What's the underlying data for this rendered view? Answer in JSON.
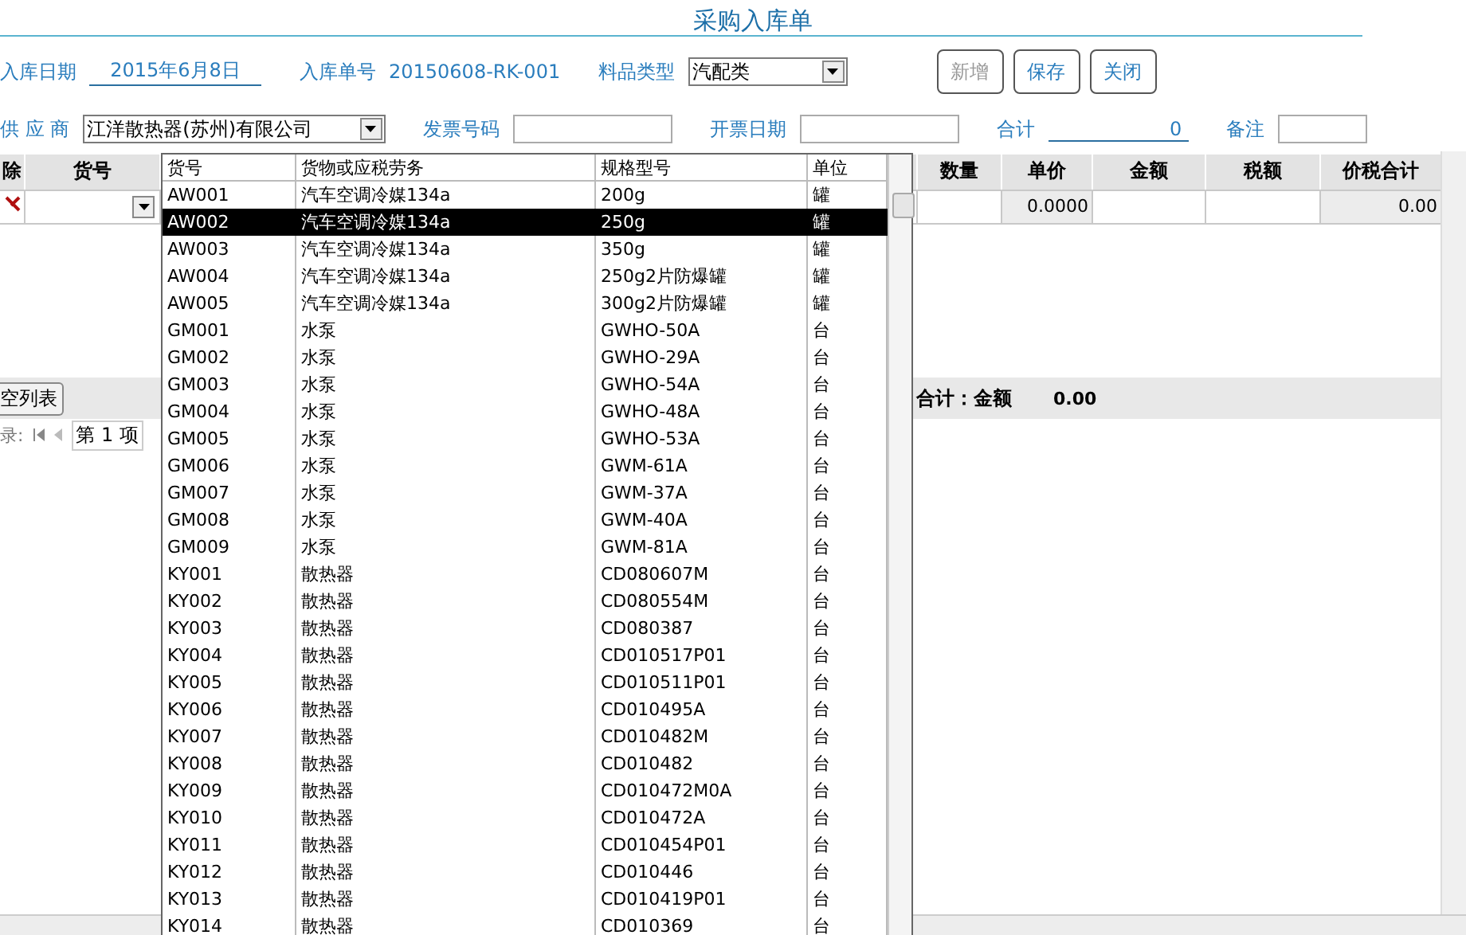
{
  "title": "采购入库单",
  "form_rows": [
    [
      {
        "label": "入库日期",
        "kind": "underline",
        "value": "2015年6月8日"
      },
      {
        "label": "入库单号",
        "kind": "text",
        "value": "20150608-RK-001"
      },
      {
        "label": "料品类型",
        "kind": "select",
        "value": "汽配类"
      }
    ],
    [
      {
        "label": "供 应 商",
        "kind": "select",
        "value": "江洋散热器(苏州)有限公司"
      },
      {
        "label": "发票号码",
        "kind": "input"
      },
      {
        "label": "开票日期",
        "kind": "input"
      },
      {
        "label": "合计",
        "kind": "underline",
        "value": "0"
      },
      {
        "label": "备注",
        "kind": "input"
      }
    ]
  ],
  "buttons": [
    {
      "label": "新增",
      "disabled": true
    },
    {
      "label": "保存",
      "disabled": false
    },
    {
      "label": "关闭",
      "disabled": false
    }
  ],
  "grid": {
    "columns": [
      "除",
      "货号",
      "",
      "数量",
      "单价",
      "金额",
      "税额",
      "价税合计"
    ],
    "row": {
      "unit_price": "0.0000",
      "price_tax_total": "0.00"
    }
  },
  "clear_button": "空列表",
  "total_label": "合计：金额",
  "total_value": "0.00",
  "nav": {
    "label": "录:",
    "position": "第 1 项"
  },
  "dropdown": {
    "columns": [
      "货号",
      "货物或应税劳务",
      "规格型号",
      "单位"
    ],
    "rows": [
      {
        "cells": [
          "AW001",
          "汽车空调冷媒134a",
          "200g",
          "罐"
        ],
        "selected": false
      },
      {
        "cells": [
          "AW002",
          "汽车空调冷媒134a",
          "250g",
          "罐"
        ],
        "selected": true
      },
      {
        "cells": [
          "AW003",
          "汽车空调冷媒134a",
          "350g",
          "罐"
        ],
        "selected": false
      },
      {
        "cells": [
          "AW004",
          "汽车空调冷媒134a",
          "250g2片防爆罐",
          "罐"
        ],
        "selected": false
      },
      {
        "cells": [
          "AW005",
          "汽车空调冷媒134a",
          "300g2片防爆罐",
          "罐"
        ],
        "selected": false
      },
      {
        "cells": [
          "GM001",
          "水泵",
          "GWHO-50A",
          "台"
        ],
        "selected": false
      },
      {
        "cells": [
          "GM002",
          "水泵",
          "GWHO-29A",
          "台"
        ],
        "selected": false
      },
      {
        "cells": [
          "GM003",
          "水泵",
          "GWHO-54A",
          "台"
        ],
        "selected": false
      },
      {
        "cells": [
          "GM004",
          "水泵",
          "GWHO-48A",
          "台"
        ],
        "selected": false
      },
      {
        "cells": [
          "GM005",
          "水泵",
          "GWHO-53A",
          "台"
        ],
        "selected": false
      },
      {
        "cells": [
          "GM006",
          "水泵",
          "GWM-61A",
          "台"
        ],
        "selected": false
      },
      {
        "cells": [
          "GM007",
          "水泵",
          "GWM-37A",
          "台"
        ],
        "selected": false
      },
      {
        "cells": [
          "GM008",
          "水泵",
          "GWM-40A",
          "台"
        ],
        "selected": false
      },
      {
        "cells": [
          "GM009",
          "水泵",
          "GWM-81A",
          "台"
        ],
        "selected": false
      },
      {
        "cells": [
          "KY001",
          "散热器",
          "CD080607M",
          "台"
        ],
        "selected": false
      },
      {
        "cells": [
          "KY002",
          "散热器",
          "CD080554M",
          "台"
        ],
        "selected": false
      },
      {
        "cells": [
          "KY003",
          "散热器",
          "CD080387",
          "台"
        ],
        "selected": false
      },
      {
        "cells": [
          "KY004",
          "散热器",
          "CD010517P01",
          "台"
        ],
        "selected": false
      },
      {
        "cells": [
          "KY005",
          "散热器",
          "CD010511P01",
          "台"
        ],
        "selected": false
      },
      {
        "cells": [
          "KY006",
          "散热器",
          "CD010495A",
          "台"
        ],
        "selected": false
      },
      {
        "cells": [
          "KY007",
          "散热器",
          "CD010482M",
          "台"
        ],
        "selected": false
      },
      {
        "cells": [
          "KY008",
          "散热器",
          "CD010482",
          "台"
        ],
        "selected": false
      },
      {
        "cells": [
          "KY009",
          "散热器",
          "CD010472M0A",
          "台"
        ],
        "selected": false
      },
      {
        "cells": [
          "KY010",
          "散热器",
          "CD010472A",
          "台"
        ],
        "selected": false
      },
      {
        "cells": [
          "KY011",
          "散热器",
          "CD010454P01",
          "台"
        ],
        "selected": false
      },
      {
        "cells": [
          "KY012",
          "散热器",
          "CD010446",
          "台"
        ],
        "selected": false
      },
      {
        "cells": [
          "KY013",
          "散热器",
          "CD010419P01",
          "台"
        ],
        "selected": false
      },
      {
        "cells": [
          "KY014",
          "散热器",
          "CD010369",
          "台"
        ],
        "selected": false
      }
    ]
  }
}
